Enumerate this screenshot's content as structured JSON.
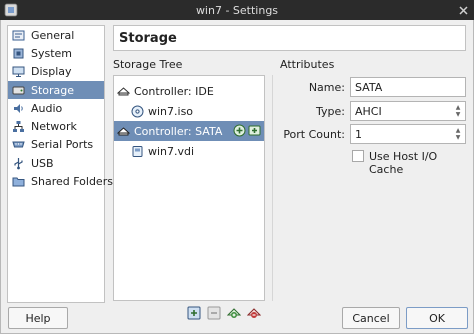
{
  "window": {
    "title": "win7 - Settings"
  },
  "sidebar": {
    "items": [
      {
        "label": "General",
        "icon": "general-icon"
      },
      {
        "label": "System",
        "icon": "system-icon"
      },
      {
        "label": "Display",
        "icon": "display-icon"
      },
      {
        "label": "Storage",
        "icon": "storage-icon",
        "selected": true
      },
      {
        "label": "Audio",
        "icon": "audio-icon"
      },
      {
        "label": "Network",
        "icon": "network-icon"
      },
      {
        "label": "Serial Ports",
        "icon": "serial-ports-icon"
      },
      {
        "label": "USB",
        "icon": "usb-icon"
      },
      {
        "label": "Shared Folders",
        "icon": "shared-folders-icon"
      }
    ]
  },
  "page": {
    "title": "Storage"
  },
  "storage_tree": {
    "label": "Storage Tree",
    "rows": [
      {
        "label": "Controller: IDE",
        "kind": "controller"
      },
      {
        "label": "win7.iso",
        "kind": "optical"
      },
      {
        "label": "Controller: SATA",
        "kind": "controller",
        "selected": true
      },
      {
        "label": "win7.vdi",
        "kind": "disk"
      }
    ]
  },
  "attributes": {
    "label": "Attributes",
    "name_label": "Name:",
    "name_value": "SATA",
    "type_label": "Type:",
    "type_value": "AHCI",
    "port_count_label": "Port Count:",
    "port_count_value": "1",
    "host_io_cache_label": "Use Host I/O Cache",
    "host_io_cache_checked": false
  },
  "buttons": {
    "help": "Help",
    "cancel": "Cancel",
    "ok": "OK"
  },
  "colors": {
    "selection": "#6f8eb6",
    "titlebar": "#2b2b2b"
  }
}
